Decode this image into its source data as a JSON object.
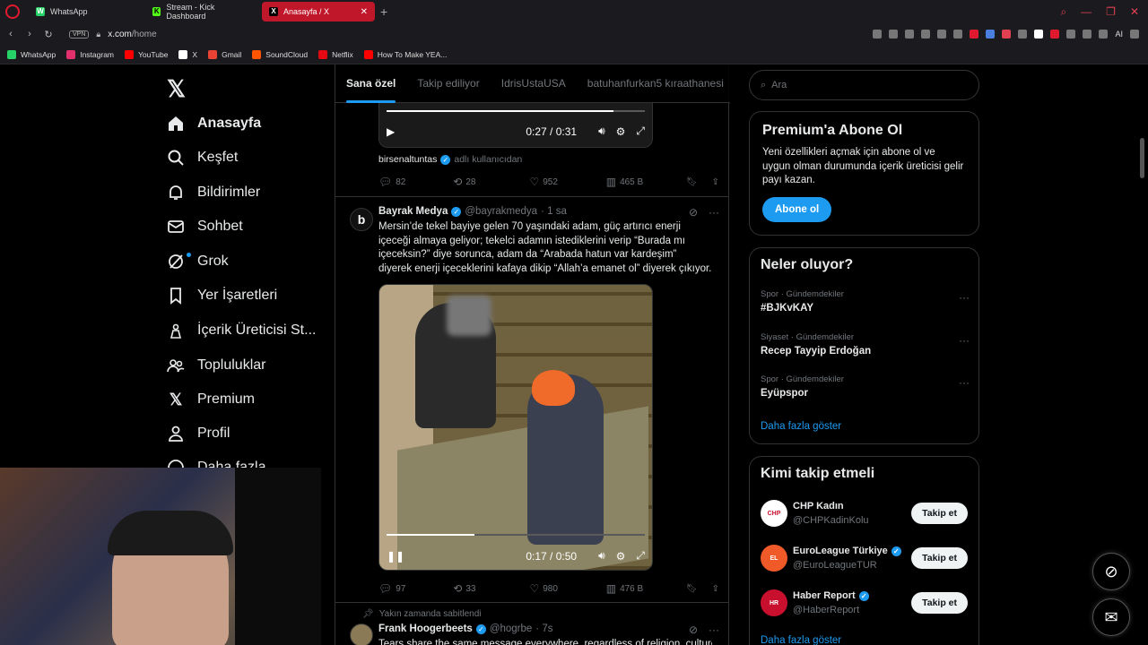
{
  "browser": {
    "tabs": [
      {
        "label": "WhatsApp",
        "color": "#25d366",
        "glyph": "W"
      },
      {
        "label": "Stream - Kick Dashboard",
        "color": "#53fc18",
        "glyph": "K"
      },
      {
        "label": "Anasayfa / X",
        "color": "#000000",
        "glyph": "X"
      }
    ],
    "vpn": "VPN",
    "url_host": "x.com",
    "url_path": "/home",
    "ai_label": "AI",
    "bookmarks": [
      {
        "label": "WhatsApp",
        "color": "#25d366"
      },
      {
        "label": "Instagram",
        "color": "#e1306c"
      },
      {
        "label": "YouTube",
        "color": "#ff0000"
      },
      {
        "label": "X",
        "color": "#ffffff"
      },
      {
        "label": "Gmail",
        "color": "#ea4335"
      },
      {
        "label": "SoundCloud",
        "color": "#ff5500"
      },
      {
        "label": "Netflix",
        "color": "#e50914"
      },
      {
        "label": "How To Make YEA...",
        "color": "#ff0000"
      }
    ]
  },
  "nav": {
    "items": [
      {
        "label": "Anasayfa",
        "icon": "home-icon"
      },
      {
        "label": "Keşfet",
        "icon": "search-icon"
      },
      {
        "label": "Bildirimler",
        "icon": "bell-icon"
      },
      {
        "label": "Sohbet",
        "icon": "mail-icon"
      },
      {
        "label": "Grok",
        "icon": "grok-icon"
      },
      {
        "label": "Yer İşaretleri",
        "icon": "bookmark-icon"
      },
      {
        "label": "İçerik Üreticisi St...",
        "icon": "creator-icon"
      },
      {
        "label": "Topluluklar",
        "icon": "communities-icon"
      },
      {
        "label": "Premium",
        "icon": "x-icon"
      },
      {
        "label": "Profil",
        "icon": "profile-icon"
      },
      {
        "label": "Daha fazla",
        "icon": "more-icon"
      }
    ]
  },
  "timeline": {
    "tabs": [
      "Sana özel",
      "Takip ediliyor",
      "IdrisUstaUSA",
      "batuhanfurkan5 kıraathanesi"
    ],
    "tweet1": {
      "video_time": "0:27 / 0:31",
      "video_progress": 0.88,
      "via_user": "birsenaltuntas",
      "via_suffix": "adlı kullanıcıdan",
      "replies": "82",
      "reposts": "28",
      "likes": "952",
      "views": "465 B"
    },
    "tweet2": {
      "avatar": "b",
      "name": "Bayrak Medya",
      "handle": "@bayrakmedya",
      "time": "· 1 sa",
      "text": "Mersin’de tekel bayiye gelen 70 yaşındaki adam, güç artırıcı enerji içeceği almaya geliyor; tekelci adamın istediklerini verip “Burada mı içeceksin?” diye sorunca, adam da “Arabada hatun var kardeşim” diyerek enerji içeceklerini kafaya dikip “Allah’a emanet ol” diyerek çıkıyor.",
      "video_time": "0:17 / 0:50",
      "video_progress": 0.34,
      "replies": "97",
      "reposts": "33",
      "likes": "980",
      "views": "476 B"
    },
    "pinned_label": "Yakın zamanda sabitlendi",
    "tweet3": {
      "name": "Frank Hoogerbeets",
      "handle": "@hogrbe",
      "time": "· 7s",
      "text": "Tears share the same message everywhere, regardless of religion, culture or"
    }
  },
  "right": {
    "search_placeholder": "Ara",
    "premium": {
      "title": "Premium'a Abone Ol",
      "text": "Yeni özellikleri açmak için abone ol ve uygun olman durumunda içerik üreticisi gelir payı kazan.",
      "button": "Abone ol"
    },
    "trends": {
      "title": "Neler oluyor?",
      "items": [
        {
          "category": "Spor · Gündemdekiler",
          "title": "#BJKvKAY"
        },
        {
          "category": "Siyaset · Gündemdekiler",
          "title": "Recep Tayyip Erdoğan"
        },
        {
          "category": "Spor · Gündemdekiler",
          "title": "Eyüpspor"
        }
      ],
      "show_more": "Daha fazla göster"
    },
    "follow": {
      "title": "Kimi takip etmeli",
      "items": [
        {
          "name": "CHP Kadın",
          "handle": "@CHPKadinKolu",
          "verified": false,
          "button": "Takip et",
          "avatar_color": "#ffffff"
        },
        {
          "name": "EuroLeague Türkiye",
          "handle": "@EuroLeagueTUR",
          "verified": true,
          "button": "Takip et",
          "avatar_color": "#f05a28"
        },
        {
          "name": "Haber Report",
          "handle": "@HaberReport",
          "verified": true,
          "button": "Takip et",
          "avatar_color": "#c8102e"
        }
      ],
      "show_more": "Daha fazla göster"
    }
  },
  "colors": {
    "accent": "#1d9bf0",
    "opera": "#e0192f"
  }
}
